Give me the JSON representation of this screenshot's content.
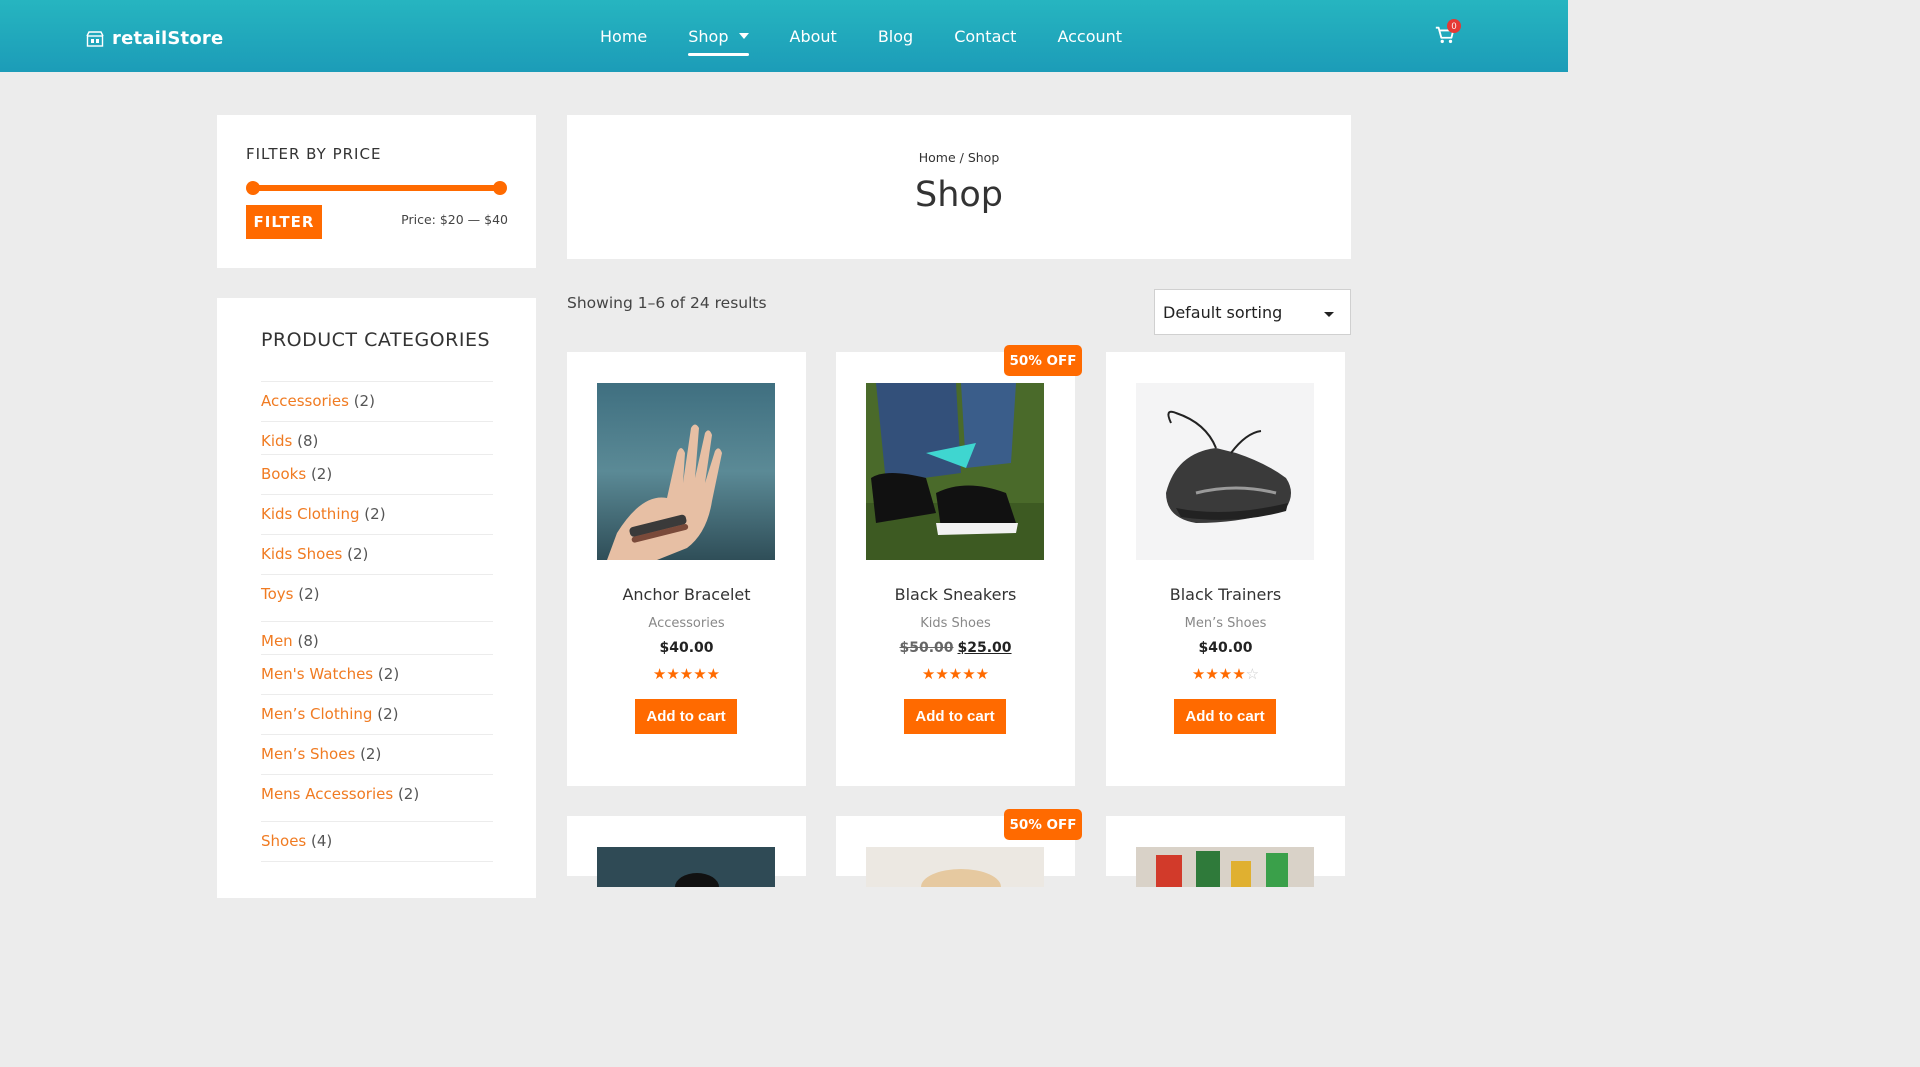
{
  "header": {
    "logo_text": "retailStore",
    "nav": [
      {
        "label": "Home"
      },
      {
        "label": "Shop",
        "active": true,
        "has_dropdown": true
      },
      {
        "label": "About"
      },
      {
        "label": "Blog"
      },
      {
        "label": "Contact"
      },
      {
        "label": "Account"
      }
    ],
    "cart_count": "0",
    "accent_color": "#1fa9bc"
  },
  "price_filter": {
    "title": "FILTER BY PRICE",
    "button_label": "FILTER",
    "range_text": "Price: $20 — $40",
    "min_fraction": 0,
    "max_fraction": 1
  },
  "categories": {
    "title": "PRODUCT CATEGORIES",
    "items": [
      {
        "name": "Accessories",
        "count": "(2)"
      },
      {
        "name": "Kids",
        "count": "(8)"
      },
      {
        "name": "Books",
        "count": "(2)"
      },
      {
        "name": "Kids Clothing",
        "count": "(2)"
      },
      {
        "name": "Kids Shoes",
        "count": "(2)"
      },
      {
        "name": "Toys",
        "count": "(2)"
      },
      {
        "name": "Men",
        "count": "(8)"
      },
      {
        "name": "Men's Watches",
        "count": "(2)"
      },
      {
        "name": "Men’s Clothing",
        "count": "(2)"
      },
      {
        "name": "Men’s Shoes",
        "count": "(2)"
      },
      {
        "name": "Mens Accessories",
        "count": "(2)"
      },
      {
        "name": "Shoes",
        "count": "(4)"
      }
    ]
  },
  "main": {
    "breadcrumb": {
      "home": "Home",
      "separator": " / ",
      "current": "Shop"
    },
    "page_title": "Shop",
    "result_count": "Showing 1–6 of 24 results",
    "sort_selected": "Default sorting"
  },
  "products": [
    {
      "name": "Anchor Bracelet",
      "category": "Accessories",
      "price": "$40.00",
      "old_price": "",
      "rating": 5,
      "button": "Add to cart",
      "badge": ""
    },
    {
      "name": "Black Sneakers",
      "category": "Kids Shoes",
      "price": "$25.00",
      "old_price": "$50.00",
      "rating": 5,
      "button": "Add to cart",
      "badge": "50% OFF"
    },
    {
      "name": "Black Trainers",
      "category": "Men’s Shoes",
      "price": "$40.00",
      "old_price": "",
      "rating": 4,
      "button": "Add to cart",
      "badge": ""
    }
  ],
  "second_row_badge": "50% OFF",
  "brand_color": "#ff6a00"
}
